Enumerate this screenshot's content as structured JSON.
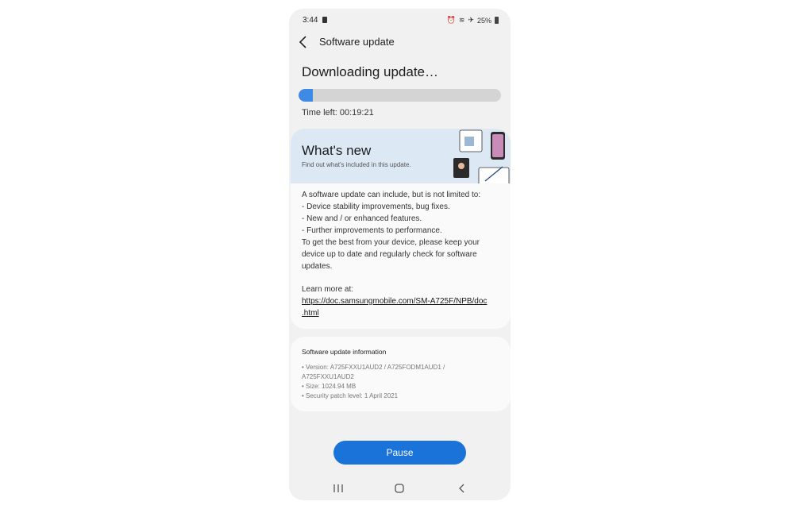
{
  "status_bar": {
    "time": "3:44",
    "battery": "25%",
    "icons": [
      "sim-icon",
      "alarm-icon",
      "wifi-icon",
      "airplane-icon",
      "battery-icon"
    ]
  },
  "app_bar": {
    "title": "Software update",
    "back_icon": "back-arrow-icon"
  },
  "download": {
    "heading": "Downloading update…",
    "progress": 0.07,
    "time_left": "Time left: 00:19:21"
  },
  "whats_new": {
    "title": "What's new",
    "subtitle": "Find out what's included in this update.",
    "illustration": "devices-illustration"
  },
  "description": {
    "lines": [
      "A software update can include, but is not limited to:",
      " - Device stability improvements, bug fixes.",
      " - New and / or enhanced features.",
      " - Further improvements to performance.",
      "To get the best from your device, please keep your",
      "device up to date and regularly check for software",
      "updates."
    ],
    "learn_more": "Learn more at:",
    "link_line1": "https://doc.samsungmobile.com/SM-A725F/NPB/doc",
    "link_line2": ".html"
  },
  "info": {
    "title": "Software update information",
    "lines": [
      "• Version: A725FXXU1AUD2 / A725FODM1AUD1 /",
      "   A725FXXU1AUD2",
      "• Size: 1024.94 MB",
      "• Security patch level: 1 April 2021"
    ]
  },
  "actions": {
    "pause_label": "Pause"
  },
  "nav_bar": {
    "icons": [
      "recents-icon",
      "home-icon",
      "back-icon"
    ]
  },
  "colors": {
    "accent": "#1a73d9",
    "progress": "#3f8ae6",
    "banner": "#dde8f5"
  }
}
